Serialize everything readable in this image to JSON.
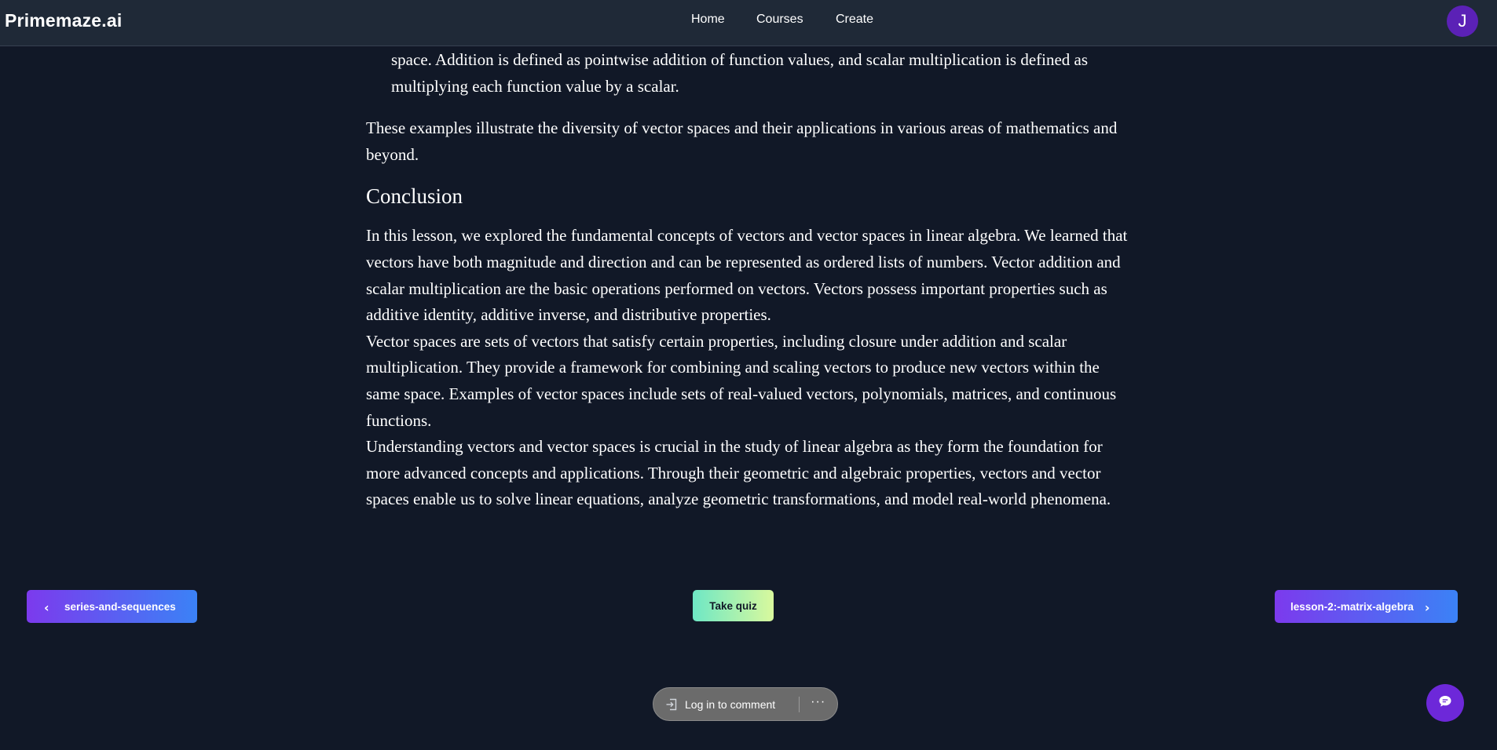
{
  "header": {
    "brand": "Primemaze.ai",
    "nav": [
      {
        "label": "Home"
      },
      {
        "label": "Courses"
      },
      {
        "label": "Create"
      }
    ],
    "avatar_initial": "J"
  },
  "article": {
    "list_continuation": "space. Addition is defined as pointwise addition of function values, and scalar multiplication is defined as multiplying each function value by a scalar.",
    "examples_summary": "These examples illustrate the diversity of vector spaces and their applications in various areas of mathematics and beyond.",
    "conclusion_heading": "Conclusion",
    "conclusion_p1": "In this lesson, we explored the fundamental concepts of vectors and vector spaces in linear algebra. We learned that vectors have both magnitude and direction and can be represented as ordered lists of numbers. Vector addition and scalar multiplication are the basic operations performed on vectors. Vectors possess important properties such as additive identity, additive inverse, and distributive properties.",
    "conclusion_p2": "Vector spaces are sets of vectors that satisfy certain properties, including closure under addition and scalar multiplication. They provide a framework for combining and scaling vectors to produce new vectors within the same space. Examples of vector spaces include sets of real-valued vectors, polynomials, matrices, and continuous functions.",
    "conclusion_p3": "Understanding vectors and vector spaces is crucial in the study of linear algebra as they form the foundation for more advanced concepts and applications. Through their geometric and algebraic properties, vectors and vector spaces enable us to solve linear equations, analyze geometric transformations, and model real-world phenomena."
  },
  "navigation": {
    "prev_label": "series-and-sequences",
    "quiz_label": "Take quiz",
    "next_label": "lesson-2:-matrix-algebra"
  },
  "comments": {
    "login_label": "Log in to comment",
    "more_label": "···"
  },
  "icons": {
    "prev": "chevron-left-icon",
    "next": "chevron-right-icon",
    "login": "login-arrow-icon",
    "chat": "chat-bubble-icon"
  },
  "colors": {
    "background": "#111827",
    "header": "#1f2937",
    "avatar": "#5b21b6",
    "nav_button_gradient_start": "#7c3aed",
    "nav_button_gradient_end": "#3b82f6",
    "quiz_gradient_start": "#6ee7c5",
    "quiz_gradient_end": "#d9f99d",
    "chat_fab": "#6d28d9"
  }
}
